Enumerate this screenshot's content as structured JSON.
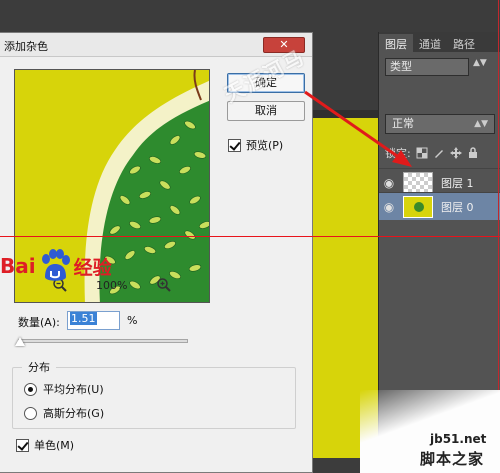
{
  "dialog": {
    "title": "添加杂色",
    "close_label": "✕",
    "ok_label": "确定",
    "cancel_label": "取消",
    "preview_label": "预览(P)",
    "preview_checked": true,
    "zoom_percent": "100%",
    "amount_label": "数量(A):",
    "amount_value": "1.51",
    "amount_unit": "%",
    "amount_slider_fraction": 0.01,
    "distribution_label": "分布",
    "uniform_label": "平均分布(U)",
    "gaussian_label": "高斯分布(G)",
    "distribution_selected": "uniform",
    "monochrome_label": "单色(M)",
    "monochrome_checked": true
  },
  "layers_panel": {
    "tabs": [
      "图层",
      "通道",
      "路径"
    ],
    "filter_label": "类型",
    "blend_mode": "正常",
    "lock_label": "锁定:",
    "layers": [
      {
        "name": "图层 1",
        "selected": false,
        "thumbnail": "transparent"
      },
      {
        "name": "图层 0",
        "selected": true,
        "thumbnail": "yellow-tree"
      }
    ]
  },
  "watermarks": {
    "top": "天涯河马",
    "baidu_bai": "Bai",
    "baidu_jingyan": "经验",
    "jb51_url": "jb51.net",
    "jb51_name": "脚本之家"
  },
  "colors": {
    "canvas_yellow": "#d7d40a",
    "leaf_green": "#2e8b2e",
    "selection_blue": "#6d85a5",
    "close_red": "#c7423b",
    "guide_red": "#e8131b"
  }
}
